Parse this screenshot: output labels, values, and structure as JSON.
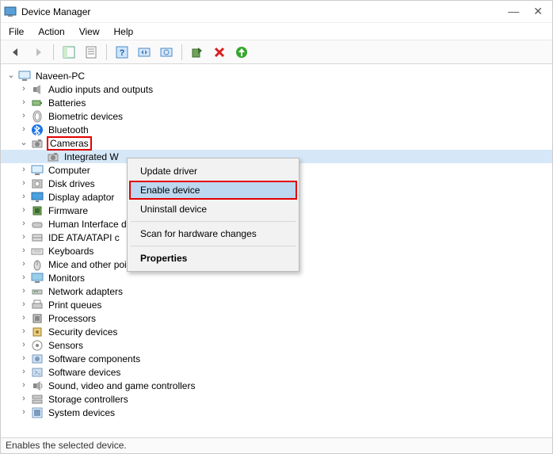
{
  "titlebar": {
    "title": "Device Manager"
  },
  "menubar": {
    "file": "File",
    "action": "Action",
    "view": "View",
    "help": "Help"
  },
  "statusbar": {
    "text": "Enables the selected device."
  },
  "root": {
    "label": "Naveen-PC"
  },
  "categories": [
    {
      "label": "Audio inputs and outputs",
      "icon": "speaker"
    },
    {
      "label": "Batteries",
      "icon": "battery"
    },
    {
      "label": "Biometric devices",
      "icon": "finger"
    },
    {
      "label": "Bluetooth",
      "icon": "bluetooth"
    },
    {
      "label": "Cameras",
      "icon": "camera",
      "expanded": true,
      "highlight": true,
      "children": [
        {
          "label": "Integrated W",
          "icon": "camera",
          "selected": true
        }
      ]
    },
    {
      "label": "Computer",
      "icon": "computer"
    },
    {
      "label": "Disk drives",
      "icon": "disk"
    },
    {
      "label": "Display adaptor",
      "icon": "display"
    },
    {
      "label": "Firmware",
      "icon": "chip"
    },
    {
      "label": "Human Interface d",
      "icon": "hid"
    },
    {
      "label": "IDE ATA/ATAPI c",
      "icon": "ide"
    },
    {
      "label": "Keyboards",
      "icon": "keyboard"
    },
    {
      "label": "Mice and other pointing devices",
      "icon": "mouse"
    },
    {
      "label": "Monitors",
      "icon": "monitor"
    },
    {
      "label": "Network adapters",
      "icon": "network"
    },
    {
      "label": "Print queues",
      "icon": "printer"
    },
    {
      "label": "Processors",
      "icon": "cpu"
    },
    {
      "label": "Security devices",
      "icon": "security"
    },
    {
      "label": "Sensors",
      "icon": "sensor"
    },
    {
      "label": "Software components",
      "icon": "softcomp"
    },
    {
      "label": "Software devices",
      "icon": "softdev"
    },
    {
      "label": "Sound, video and game controllers",
      "icon": "sound"
    },
    {
      "label": "Storage controllers",
      "icon": "storage"
    },
    {
      "label": "System devices",
      "icon": "system"
    }
  ],
  "context_menu": {
    "update": "Update driver",
    "enable": "Enable device",
    "uninstall": "Uninstall device",
    "scan": "Scan for hardware changes",
    "properties": "Properties"
  }
}
